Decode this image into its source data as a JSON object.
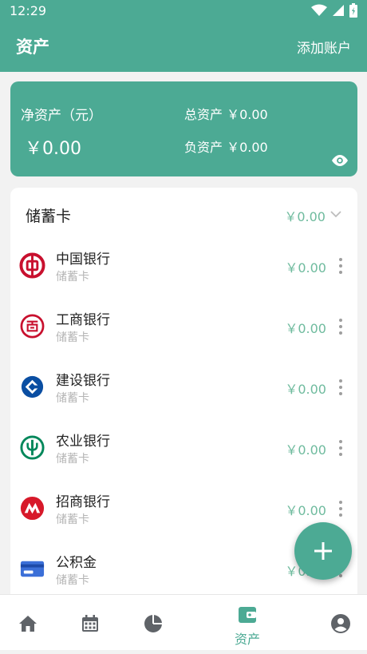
{
  "status": {
    "time": "12:29"
  },
  "toolbar": {
    "title": "资产",
    "action": "添加账户"
  },
  "summary": {
    "net_label": "净资产（元）",
    "net_value": "￥0.00",
    "total": "总资产 ￥0.00",
    "debt": "负资产 ￥0.00"
  },
  "group": {
    "title": "储蓄卡",
    "amount": "￥0.00"
  },
  "accounts": [
    {
      "name": "中国银行",
      "type": "储蓄卡",
      "amount": "￥0.00",
      "icon": "boc-logo-icon",
      "color": "#c8102e"
    },
    {
      "name": "工商银行",
      "type": "储蓄卡",
      "amount": "￥0.00",
      "icon": "icbc-logo-icon",
      "color": "#c8102e"
    },
    {
      "name": "建设银行",
      "type": "储蓄卡",
      "amount": "￥0.00",
      "icon": "ccb-logo-icon",
      "color": "#0a4ea2"
    },
    {
      "name": "农业银行",
      "type": "储蓄卡",
      "amount": "￥0.00",
      "icon": "abc-logo-icon",
      "color": "#00875a"
    },
    {
      "name": "招商银行",
      "type": "储蓄卡",
      "amount": "￥0.00",
      "icon": "cmb-logo-icon",
      "color": "#d7192a"
    },
    {
      "name": "公积金",
      "type": "储蓄卡",
      "amount": "￥0.00",
      "icon": "card-icon",
      "color": "#3b6fd8"
    }
  ],
  "nav": {
    "items": [
      {
        "icon": "home-icon"
      },
      {
        "icon": "calendar-icon"
      },
      {
        "icon": "pie-chart-icon"
      },
      {
        "icon": "wallet-icon",
        "label": "资产",
        "active": true
      },
      {
        "icon": "account-icon"
      }
    ]
  },
  "colors": {
    "primary": "#4caa94",
    "amount": "#6fbb9e"
  }
}
